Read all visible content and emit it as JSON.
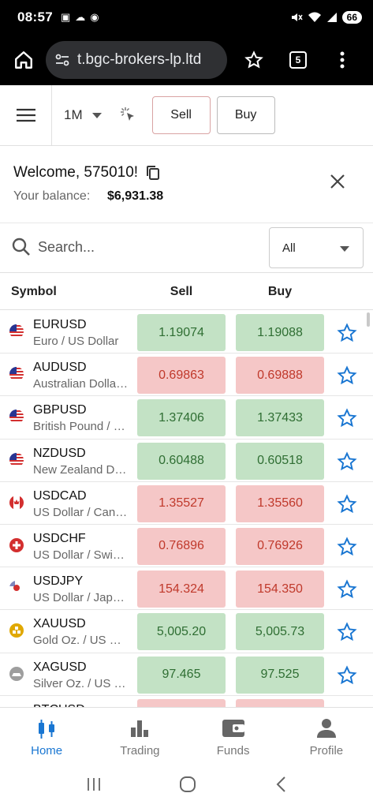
{
  "status": {
    "time": "08:57",
    "battery": "66"
  },
  "browser": {
    "url": "​t.bgc-brokers-lp.ltd",
    "tab_count": "5"
  },
  "toolbar": {
    "timeframe": "1M",
    "sell_label": "Sell",
    "buy_label": "Buy"
  },
  "welcome": {
    "greeting": "Welcome, 575010!",
    "balance_label": "Your balance:",
    "balance_value": "$6,931.38"
  },
  "search": {
    "placeholder": "Search...",
    "filter_value": "All"
  },
  "table": {
    "headers": {
      "symbol": "Symbol",
      "sell": "Sell",
      "buy": "Buy"
    },
    "rows": [
      {
        "symbol": "EURUSD",
        "desc": "Euro / US Dollar",
        "sell": "1.19074",
        "buy": "1.19088",
        "trend": "up",
        "flag": "us"
      },
      {
        "symbol": "AUDUSD",
        "desc": "Australian Dollar / US Dollar",
        "sell": "0.69863",
        "buy": "0.69888",
        "trend": "down",
        "flag": "us"
      },
      {
        "symbol": "GBPUSD",
        "desc": "British Pound / US Dollar",
        "sell": "1.37406",
        "buy": "1.37433",
        "trend": "up",
        "flag": "us"
      },
      {
        "symbol": "NZDUSD",
        "desc": "New Zealand Dollar / US Dollar",
        "sell": "0.60488",
        "buy": "0.60518",
        "trend": "up",
        "flag": "us"
      },
      {
        "symbol": "USDCAD",
        "desc": "US Dollar / Canadian Dollar",
        "sell": "1.35527",
        "buy": "1.35560",
        "trend": "down",
        "flag": "ca"
      },
      {
        "symbol": "USDCHF",
        "desc": "US Dollar / Swiss Franc",
        "sell": "0.76896",
        "buy": "0.76926",
        "trend": "down",
        "flag": "ch"
      },
      {
        "symbol": "USDJPY",
        "desc": "US Dollar / Japanese Yen",
        "sell": "154.324",
        "buy": "154.350",
        "trend": "down",
        "flag": "jp"
      },
      {
        "symbol": "XAUUSD",
        "desc": "Gold Oz. / US Dollar",
        "sell": "5,005.20",
        "buy": "5,005.73",
        "trend": "up",
        "flag": "gold"
      },
      {
        "symbol": "XAGUSD",
        "desc": "Silver Oz. / US Dollar",
        "sell": "97.465",
        "buy": "97.525",
        "trend": "up",
        "flag": "silver"
      },
      {
        "symbol": "BTCUSD",
        "desc": "",
        "sell": "",
        "buy": "",
        "trend": "down",
        "flag": "btc"
      }
    ]
  },
  "nav": [
    {
      "label": "Home",
      "icon": "candlestick-icon",
      "active": true
    },
    {
      "label": "Trading",
      "icon": "bar-chart-icon",
      "active": false
    },
    {
      "label": "Funds",
      "icon": "wallet-icon",
      "active": false
    },
    {
      "label": "Profile",
      "icon": "person-icon",
      "active": false
    }
  ],
  "colors": {
    "up_bg": "#c3e2c5",
    "up_text": "#2f6e33",
    "down_bg": "#f5c7c7",
    "down_text": "#c0392b",
    "accent": "#1976d2"
  }
}
